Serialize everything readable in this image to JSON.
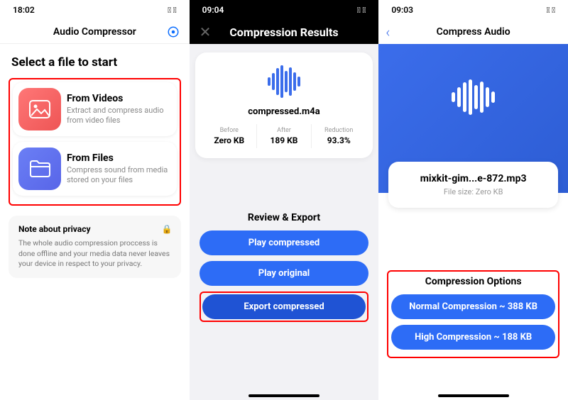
{
  "screens": {
    "left": {
      "time": "18:02",
      "statusIcons": "􀙇 􀛨",
      "title": "Audio Compressor",
      "heading": "Select a file to start",
      "options": [
        {
          "title": "From Videos",
          "sub": "Extract and compress audio from video files"
        },
        {
          "title": "From Files",
          "sub": "Compress sound from media stored on your files"
        }
      ],
      "privacy": {
        "title": "Note about privacy",
        "text": "The whole audio compression proccess is done offline and your media data never leaves your device in respect to your privacy."
      }
    },
    "mid": {
      "time": "09:04",
      "title": "Compression Results",
      "filename": "compressed.m4a",
      "stats": [
        {
          "label": "Before",
          "value": "Zero KB"
        },
        {
          "label": "After",
          "value": "189 KB"
        },
        {
          "label": "Reduction",
          "value": "93.3%"
        }
      ],
      "reviewHeading": "Review & Export",
      "buttons": [
        "Play compressed",
        "Play original",
        "Export compressed"
      ]
    },
    "right": {
      "time": "09:03",
      "title": "Compress Audio",
      "filename": "mixkit-gim...e-872.mp3",
      "filesize": "File size: Zero KB",
      "optionsTitle": "Compression Options",
      "options": [
        "Normal Compression ~ 388 KB",
        "High Compression ~ 188 KB"
      ]
    }
  }
}
